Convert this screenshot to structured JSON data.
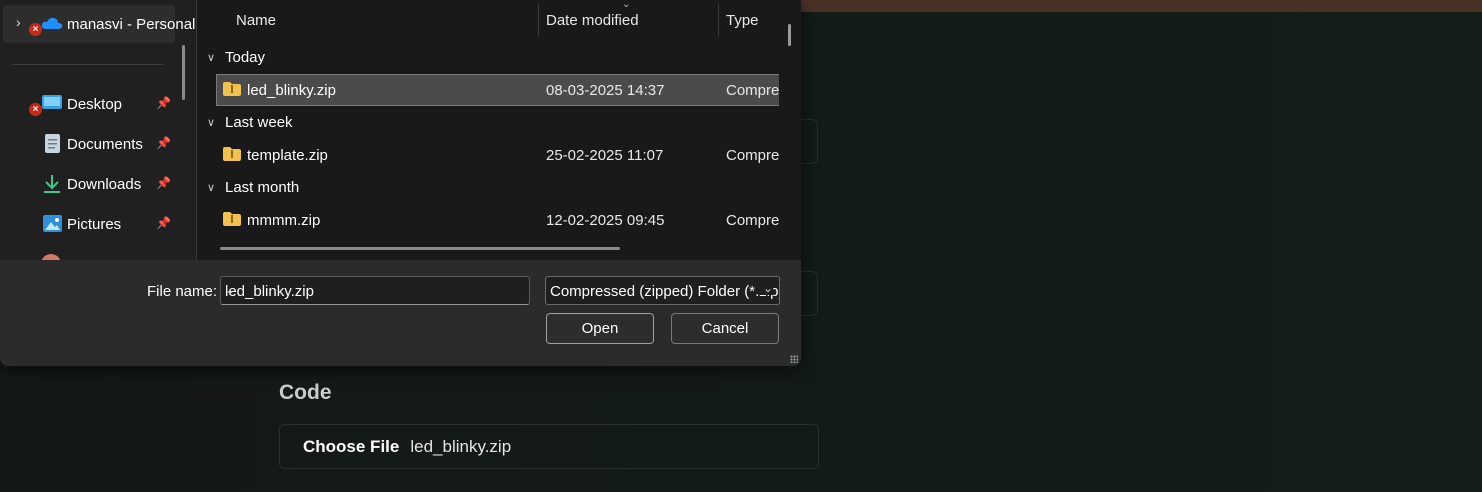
{
  "nav": {
    "items": [
      {
        "label": "manasvi - Personal",
        "icon": "onedrive-icon"
      },
      {
        "label": "Desktop",
        "icon": "desktop-icon"
      },
      {
        "label": "Documents",
        "icon": "documents-icon"
      },
      {
        "label": "Downloads",
        "icon": "downloads-icon"
      },
      {
        "label": "Pictures",
        "icon": "pictures-icon"
      }
    ]
  },
  "columns": {
    "name": "Name",
    "date": "Date modified",
    "type": "Type"
  },
  "groups": [
    {
      "label": "Today",
      "files": [
        {
          "name": "led_blinky.zip",
          "date": "08-03-2025 14:37",
          "type": "Compressed (zipped) Folder"
        }
      ]
    },
    {
      "label": "Last week",
      "files": [
        {
          "name": "template.zip",
          "date": "25-02-2025 11:07",
          "type": "Compressed (zipped) Folder"
        }
      ]
    },
    {
      "label": "Last month",
      "files": [
        {
          "name": "mmmm.zip",
          "date": "12-02-2025 09:45",
          "type": "Compressed (zipped) Folder"
        }
      ]
    }
  ],
  "footer": {
    "file_name_label": "File name:",
    "file_name_value": "led_blinky.zip",
    "file_type_value": "Compressed (zipped) Folder (*.zip)",
    "open_label": "Open",
    "cancel_label": "Cancel"
  },
  "page": {
    "code_title": "Code",
    "choose_file_label": "Choose File",
    "chosen_file": "led_blinky.zip"
  },
  "colors": {
    "error": "#c42b1c",
    "folder": "#f2c14e",
    "onedrive": "#1e90ff"
  }
}
